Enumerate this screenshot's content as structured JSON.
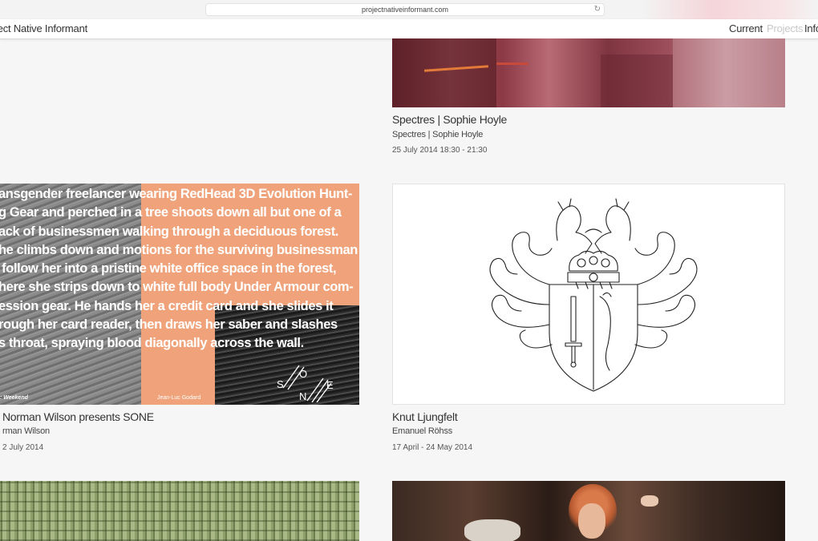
{
  "browser": {
    "url": "projectnativeinformant.com",
    "reload_icon": "↻"
  },
  "nav": {
    "site_title": "ject Native Informant",
    "links": [
      "Current",
      "Projects",
      "Info"
    ]
  },
  "cards": [
    {
      "title": "Spectres | Sophie Hoyle",
      "subtitle": "Spectres | Sophie Hoyle",
      "date": "25 July 2014 18:30 - 21:30",
      "image": "abstract-red-painting"
    },
    {
      "title": "Norman Wilson presents SONE",
      "subtitle": "rman Wilson",
      "date": "2 July 2014",
      "image": "sone-poster",
      "image_text": "ansgender freelancer wearing RedHead 3D Evolution Hunt-\ng Gear and perched in a tree shoots down all but one of a\nack of businessmen walking through a deciduous forest.\nhe climbs down and motions for the surviving businessman\n follow her into a pristine white office space in the forest,\nhere she strips down to white full body Under Armour com-\nession gear. He hands her a credit card and she slides it\nrough her card reader, then draws her saber and slashes\ns throat, spraying blood diagonally across the wall.",
      "caption_left": ": Weekend",
      "caption_right": "Jean-Luc Godard",
      "logo_letters": [
        "S",
        "O",
        "N",
        "E"
      ]
    },
    {
      "title": "Knut Ljungfelt",
      "subtitle": "Emanuel Röhss",
      "date": "17 April - 24 May 2014",
      "image": "coat-of-arms-line-drawing"
    },
    {
      "image": "greenhouse-photo"
    },
    {
      "image": "film-still-woman"
    }
  ],
  "colors": {
    "background": "#f6f6f6",
    "nav_active": "#333333",
    "nav_inactive": "#c8c8c8",
    "poster_orange": "#f0a37a"
  }
}
